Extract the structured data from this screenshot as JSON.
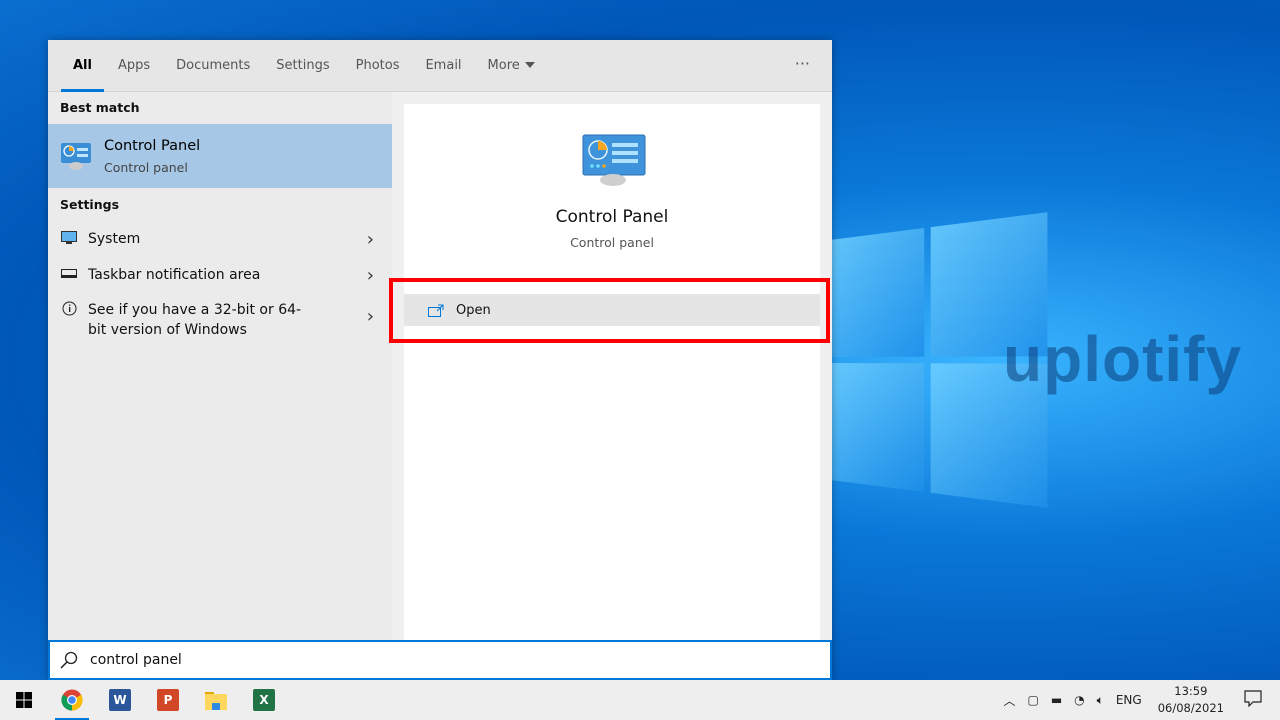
{
  "desktop": {
    "watermark": "uplotify"
  },
  "tabs": [
    {
      "label": "All",
      "active": true
    },
    {
      "label": "Apps"
    },
    {
      "label": "Documents"
    },
    {
      "label": "Settings"
    },
    {
      "label": "Photos"
    },
    {
      "label": "Email"
    },
    {
      "label": "More"
    }
  ],
  "more_options": "···",
  "left": {
    "best_match_header": "Best match",
    "best_match": {
      "title": "Control Panel",
      "subtitle": "Control panel",
      "icon": "control-panel-icon"
    },
    "settings_header": "Settings",
    "settings": [
      {
        "label": "System",
        "icon": "monitor-icon"
      },
      {
        "label": "Taskbar notification area",
        "icon": "taskbar-icon"
      },
      {
        "label": "See if you have a 32-bit or 64-bit version of Windows",
        "icon": "info-icon"
      }
    ]
  },
  "preview": {
    "title": "Control Panel",
    "subtitle": "Control panel",
    "open_label": "Open"
  },
  "search": {
    "value": "control panel"
  },
  "taskbar": {
    "apps": [
      "Chrome",
      "Word",
      "PowerPoint",
      "File Explorer",
      "Excel"
    ],
    "language": "ENG",
    "time": "13:59",
    "date": "06/08/2021"
  },
  "colors": {
    "accent": "#0078d7",
    "selected": "#a6c8e6",
    "highlight_box": "#ff0000"
  }
}
